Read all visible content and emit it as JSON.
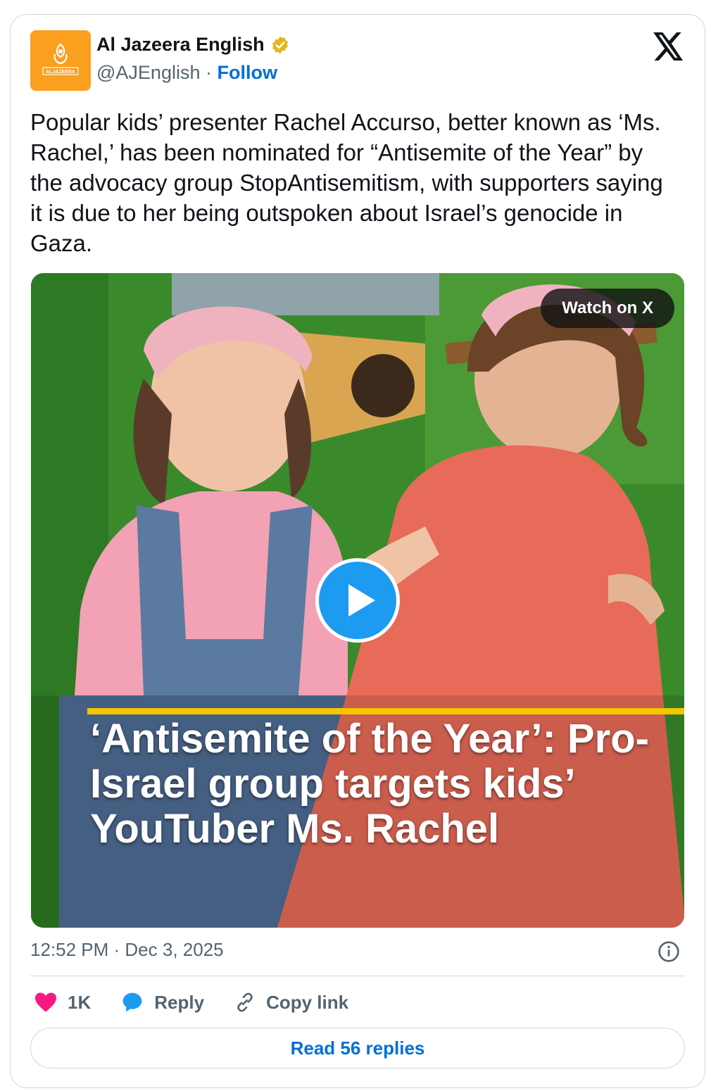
{
  "account": {
    "name": "Al Jazeera English",
    "handle": "@AJEnglish",
    "separator": "·",
    "follow_label": "Follow",
    "logo_text": "ALJAZEERA",
    "avatar_color": "#fa9f1e",
    "verified_color": "#e2b719"
  },
  "tweet": {
    "text": "Popular kids’ presenter Rachel Accurso, better known as ‘Ms. Rachel,’ has been nominated for “Antisemite of the Year” by the advocacy group StopAntisemitism, with supporters saying it is due to her being outspoken about Israel’s genocide in Gaza."
  },
  "media": {
    "watch_label": "Watch on X",
    "headline": "‘Antisemite of the Year’: Pro-Israel group targets kids’ YouTuber Ms. Rachel",
    "accent_color": "#f7c600"
  },
  "meta": {
    "timestamp": "12:52 PM · Dec 3, 2025"
  },
  "actions": {
    "like_count": "1K",
    "reply_label": "Reply",
    "copy_label": "Copy link",
    "read_replies_label": "Read 56 replies"
  },
  "colors": {
    "link": "#006fd6",
    "muted": "#536471",
    "like": "#f91880",
    "reply": "#1d9bf0"
  }
}
